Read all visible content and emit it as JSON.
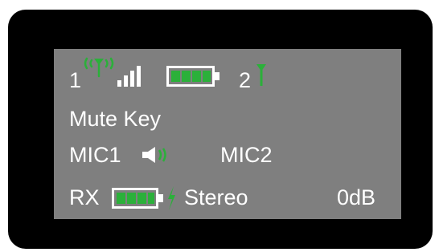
{
  "display": {
    "row1": {
      "ch1_label": "1",
      "ch2_label": "2",
      "signal_bars": 4,
      "battery_level": 1.0
    },
    "row2": {
      "menu_item": "Mute Key"
    },
    "row3": {
      "mic1_label": "MIC1",
      "mic2_label": "MIC2"
    },
    "row4": {
      "rx_label": "RX",
      "battery_level": 1.0,
      "mode_label": "Stereo",
      "gain_label": "0dB"
    }
  },
  "icons": {
    "antenna_active": "antenna-wireless-icon",
    "signal": "signal-strength-icon",
    "battery": "battery-icon",
    "antenna_idle": "antenna-icon",
    "speaker": "speaker-icon",
    "charging": "lightning-icon"
  },
  "colors": {
    "screen": "#7f7f7f",
    "accent": "#2bb03a",
    "text": "#ffffff",
    "bezel": "#000000"
  }
}
